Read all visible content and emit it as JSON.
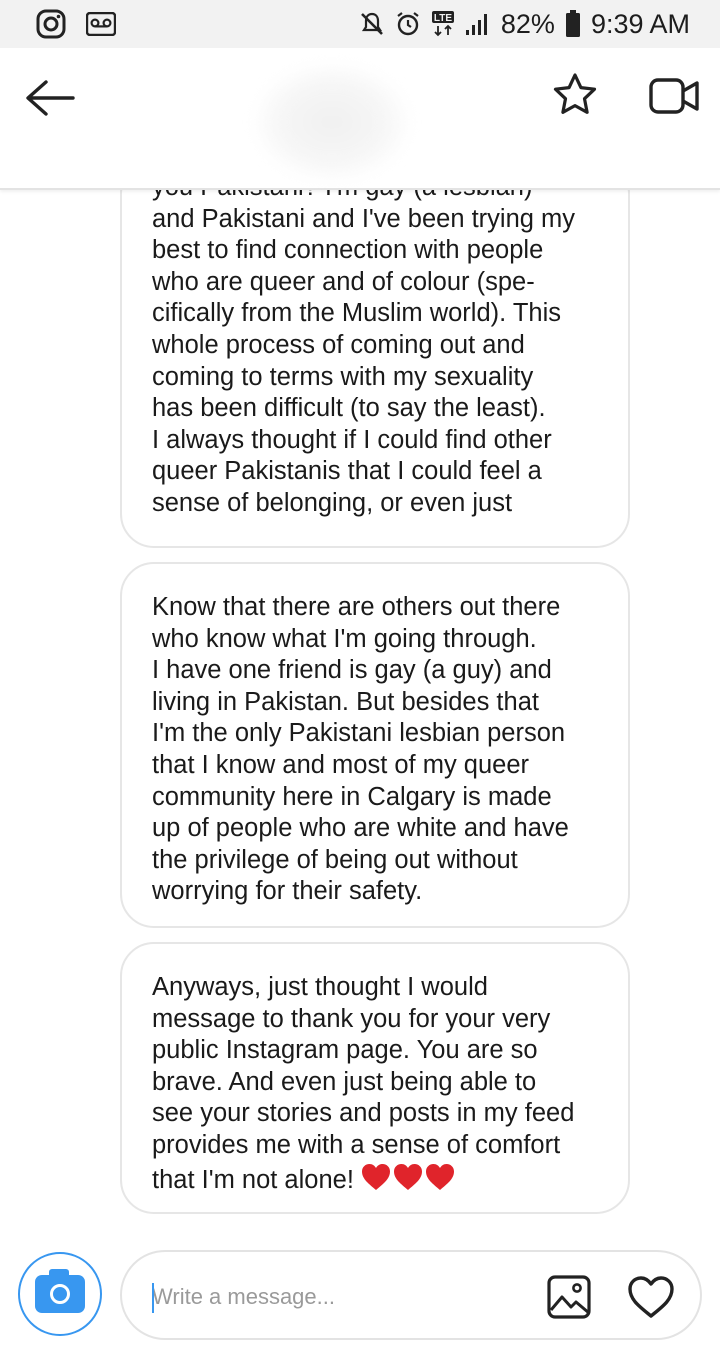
{
  "status_bar": {
    "battery": "82%",
    "time": "9:39 AM",
    "network": "LTE",
    "icons": [
      "instagram-icon",
      "voicemail-icon",
      "mute-icon",
      "alarm-icon",
      "lte-icon",
      "signal-icon",
      "battery-icon"
    ]
  },
  "header": {
    "title": "",
    "icons": [
      "back-arrow-icon",
      "star-icon",
      "video-call-icon"
    ]
  },
  "messages": [
    {
      "text": "you Pakistani? I'm gay (a lesbian)\nand Pakistani and I've been trying my\nbest to find connection with people\nwho are queer and of colour (spe-\ncifically from the Muslim world). This\nwhole process of coming out and\ncoming to terms with my sexuality\nhas been difficult (to say the least).\nI always thought if I could find other\nqueer Pakistanis that I could feel a\nsense of belonging, or even just"
    },
    {
      "text": "Know that there are others out there\nwho know what I'm going through.\nI have one friend is gay (a guy) and\nliving in Pakistan. But besides that\nI'm the only Pakistani lesbian person\nthat I know and most of my queer\ncommunity here in Calgary is made\nup of people who are white and have\nthe privilege of being out without\nworrying for their safety."
    },
    {
      "text": "Anyways, just thought I would\nmessage to thank you for your very\npublic Instagram page. You are so\nbrave. And even just being able to\nsee your stories and posts in my feed\nprovides me with a sense of comfort\nthat I'm not alone!",
      "emoji": "heart-icon",
      "emoji_count": 3
    }
  ],
  "composer": {
    "placeholder": "Write a message...",
    "icons": [
      "camera-icon",
      "gallery-icon",
      "heart-icon"
    ],
    "accent": "#3897f0"
  }
}
